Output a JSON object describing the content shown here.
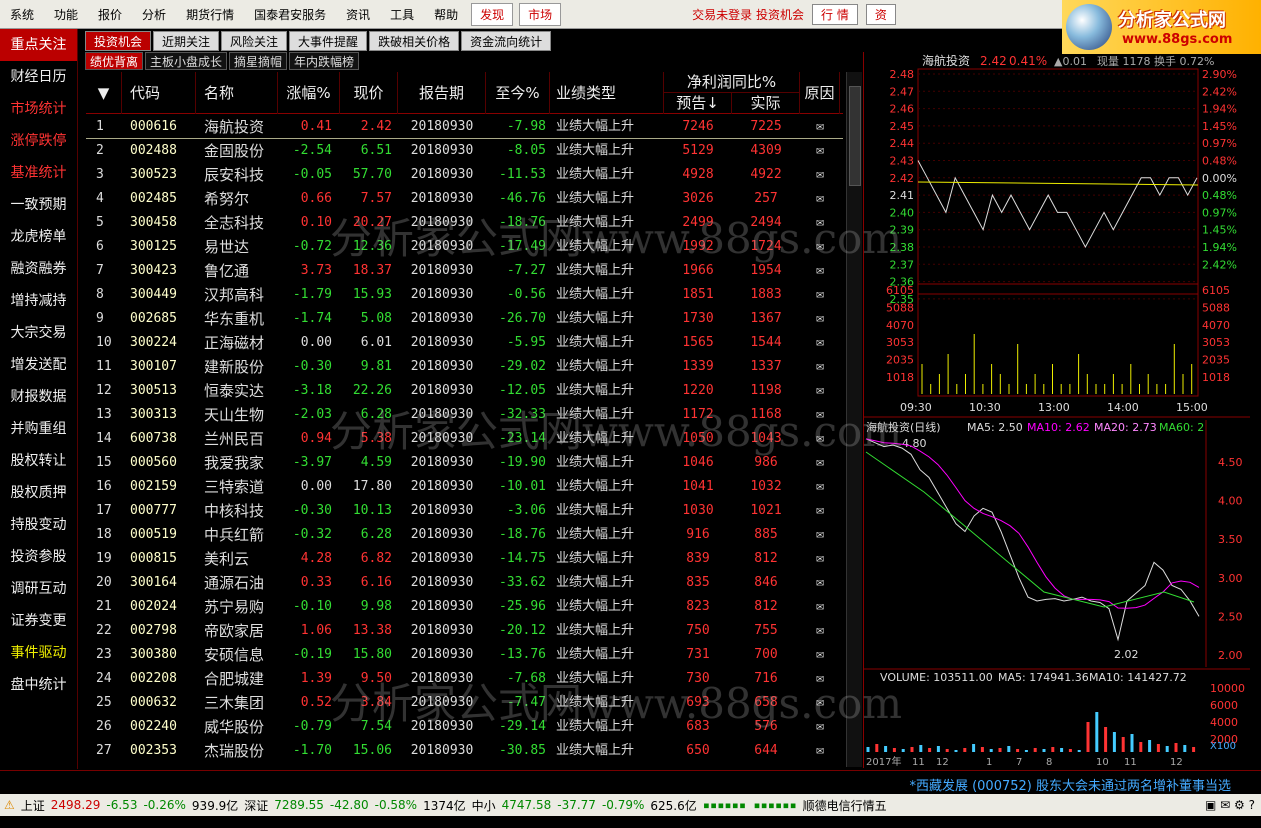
{
  "menu": {
    "items": [
      "系统",
      "功能",
      "报价",
      "分析",
      "期货行情",
      "国泰君安服务",
      "资讯",
      "工具",
      "帮助"
    ],
    "red_items": [
      "发现",
      "市场"
    ],
    "status_text": "交易未登录 投资机会",
    "btns": [
      "行 情",
      "资"
    ]
  },
  "logo": {
    "title": "分析家公式网",
    "url": "www.88gs.com"
  },
  "sidebar": {
    "items": [
      "重点关注",
      "财经日历",
      "市场统计",
      "涨停跌停",
      "基准统计",
      "一致预期",
      "龙虎榜单",
      "融资融券",
      "增持减持",
      "大宗交易",
      "增发送配",
      "财报数据",
      "并购重组",
      "股权转让",
      "股权质押",
      "持股变动",
      "投资参股",
      "调研互动",
      "证券变更",
      "事件驱动",
      "盘中统计"
    ]
  },
  "tabs1": [
    "投资机会",
    "近期关注",
    "风险关注",
    "大事件提醒",
    "跌破相关价格",
    "资金流向统计"
  ],
  "tabs2": [
    "绩优背离",
    "主板小盘成长",
    "摘星摘帽",
    "年内跌幅榜"
  ],
  "table": {
    "headers": {
      "code": "代码",
      "name": "名称",
      "chg": "涨幅%",
      "price": "现价",
      "period": "报告期",
      "sincenow": "至今%",
      "type": "业绩类型",
      "profit": "净利润同比%",
      "forecast": "预告↓",
      "actual": "实际",
      "reason": "原因"
    },
    "rows": [
      [
        "1",
        "000616",
        "海航投资",
        "0.41",
        "2.42",
        "20180930",
        "-7.98",
        "业绩大幅上升",
        "7246",
        "7225"
      ],
      [
        "2",
        "002488",
        "金固股份",
        "-2.54",
        "6.51",
        "20180930",
        "-8.05",
        "业绩大幅上升",
        "5129",
        "4309"
      ],
      [
        "3",
        "300523",
        "辰安科技",
        "-0.05",
        "57.70",
        "20180930",
        "-11.53",
        "业绩大幅上升",
        "4928",
        "4922"
      ],
      [
        "4",
        "002485",
        "希努尔",
        "0.66",
        "7.57",
        "20180930",
        "-46.76",
        "业绩大幅上升",
        "3026",
        "257"
      ],
      [
        "5",
        "300458",
        "全志科技",
        "0.10",
        "20.27",
        "20180930",
        "-18.76",
        "业绩大幅上升",
        "2499",
        "2494"
      ],
      [
        "6",
        "300125",
        "易世达",
        "-0.72",
        "12.36",
        "20180930",
        "-17.49",
        "业绩大幅上升",
        "1992",
        "1724"
      ],
      [
        "7",
        "300423",
        "鲁亿通",
        "3.73",
        "18.37",
        "20180930",
        "-7.27",
        "业绩大幅上升",
        "1966",
        "1954"
      ],
      [
        "8",
        "300449",
        "汉邦高科",
        "-1.79",
        "15.93",
        "20180930",
        "-0.56",
        "业绩大幅上升",
        "1851",
        "1883"
      ],
      [
        "9",
        "002685",
        "华东重机",
        "-1.74",
        "5.08",
        "20180930",
        "-26.70",
        "业绩大幅上升",
        "1730",
        "1367"
      ],
      [
        "10",
        "300224",
        "正海磁材",
        "0.00",
        "6.01",
        "20180930",
        "-5.95",
        "业绩大幅上升",
        "1565",
        "1544"
      ],
      [
        "11",
        "300107",
        "建新股份",
        "-0.30",
        "9.81",
        "20180930",
        "-29.02",
        "业绩大幅上升",
        "1339",
        "1337"
      ],
      [
        "12",
        "300513",
        "恒泰实达",
        "-3.18",
        "22.26",
        "20180930",
        "-12.05",
        "业绩大幅上升",
        "1220",
        "1198"
      ],
      [
        "13",
        "300313",
        "天山生物",
        "-2.03",
        "6.28",
        "20180930",
        "-32.33",
        "业绩大幅上升",
        "1172",
        "1168"
      ],
      [
        "14",
        "600738",
        "兰州民百",
        "0.94",
        "5.38",
        "20180930",
        "-23.14",
        "业绩大幅上升",
        "1050",
        "1043"
      ],
      [
        "15",
        "000560",
        "我爱我家",
        "-3.97",
        "4.59",
        "20180930",
        "-19.90",
        "业绩大幅上升",
        "1046",
        "986"
      ],
      [
        "16",
        "002159",
        "三特索道",
        "0.00",
        "17.80",
        "20180930",
        "-10.01",
        "业绩大幅上升",
        "1041",
        "1032"
      ],
      [
        "17",
        "000777",
        "中核科技",
        "-0.30",
        "10.13",
        "20180930",
        "-3.06",
        "业绩大幅上升",
        "1030",
        "1021"
      ],
      [
        "18",
        "000519",
        "中兵红箭",
        "-0.32",
        "6.28",
        "20180930",
        "-18.76",
        "业绩大幅上升",
        "916",
        "885"
      ],
      [
        "19",
        "000815",
        "美利云",
        "4.28",
        "6.82",
        "20180930",
        "-14.75",
        "业绩大幅上升",
        "839",
        "812"
      ],
      [
        "20",
        "300164",
        "通源石油",
        "0.33",
        "6.16",
        "20180930",
        "-33.62",
        "业绩大幅上升",
        "835",
        "846"
      ],
      [
        "21",
        "002024",
        "苏宁易购",
        "-0.10",
        "9.98",
        "20180930",
        "-25.96",
        "业绩大幅上升",
        "823",
        "812"
      ],
      [
        "22",
        "002798",
        "帝欧家居",
        "1.06",
        "13.38",
        "20180930",
        "-20.12",
        "业绩大幅上升",
        "750",
        "755"
      ],
      [
        "23",
        "300380",
        "安硕信息",
        "-0.19",
        "15.80",
        "20180930",
        "-13.76",
        "业绩大幅上升",
        "731",
        "700"
      ],
      [
        "24",
        "002208",
        "合肥城建",
        "1.39",
        "9.50",
        "20180930",
        "-7.68",
        "业绩大幅上升",
        "730",
        "716"
      ],
      [
        "25",
        "000632",
        "三木集团",
        "0.52",
        "3.84",
        "20180930",
        "-7.47",
        "业绩大幅上升",
        "693",
        "658"
      ],
      [
        "26",
        "002240",
        "威华股份",
        "-0.79",
        "7.54",
        "20180930",
        "-29.14",
        "业绩大幅上升",
        "683",
        "576"
      ],
      [
        "27",
        "002353",
        "杰瑞股份",
        "-1.70",
        "15.06",
        "20180930",
        "-30.85",
        "业绩大幅上升",
        "650",
        "644"
      ]
    ]
  },
  "intraday": {
    "title": "海航投资",
    "price": "2.42",
    "pct": "0.41%",
    "extra1": "▲0.01",
    "extra2": "现量 1178",
    "extra3": "换手 0.72%",
    "left_ticks": [
      "2.48",
      "2.47",
      "2.46",
      "2.45",
      "2.44",
      "2.43",
      "2.42",
      "2.41",
      "2.40",
      "2.39",
      "2.38",
      "2.37",
      "2.36",
      "2.35"
    ],
    "right_ticks": [
      "2.90%",
      "2.42%",
      "1.94%",
      "1.45%",
      "0.97%",
      "0.48%",
      "0.00%",
      "0.48%",
      "0.97%",
      "1.45%",
      "1.94%",
      "2.42%"
    ],
    "vol_ticks": [
      "6105",
      "5088",
      "4070",
      "3053",
      "2035",
      "1018"
    ],
    "times": [
      "09:30",
      "10:30",
      "13:00",
      "14:00",
      "15:00"
    ]
  },
  "daily": {
    "title": "海航投资(日线)",
    "ma5": "MA5: 2.50",
    "ma10": "MA10: 2.62",
    "ma20": "MA20: 2.73",
    "ma60": "MA60: 2",
    "high_label": "4.80",
    "low_label": "2.02",
    "ticks": [
      "4.50",
      "4.00",
      "3.50",
      "3.00",
      "2.50",
      "2.00"
    ]
  },
  "volume": {
    "title": "VOLUME: 103511.00",
    "ma5": "MA5: 174941.36",
    "ma10": "MA10: 141427.72",
    "ticks": [
      "10000",
      "6000",
      "4000",
      "2000"
    ],
    "unit": "X100",
    "dates": [
      "2017年",
      "11",
      "12",
      "1",
      "7",
      "8",
      "10",
      "11",
      "12"
    ]
  },
  "news": "*西藏发展 (000752) 股东大会未通过两名增补董事当选",
  "status": {
    "sh_label": "上证",
    "sh": "2498.29",
    "sh_chg": "-6.53",
    "sh_pct": "-0.26%",
    "sh_amt": "939.9亿",
    "sz_label": "深证",
    "sz": "7289.55",
    "sz_chg": "-42.80",
    "sz_pct": "-0.58%",
    "sz_amt": "1374亿",
    "zx_label": "中小",
    "zx": "4747.58",
    "zx_chg": "-37.77",
    "zx_pct": "-0.79%",
    "zx_amt": "625.6亿",
    "server": "顺德电信行情五"
  },
  "watermark": "分析家公式网www.88gs.com",
  "colors": {
    "up": "#ff3333",
    "down": "#33dd33",
    "flat": "#dddddd",
    "code": "#ffffcc"
  }
}
